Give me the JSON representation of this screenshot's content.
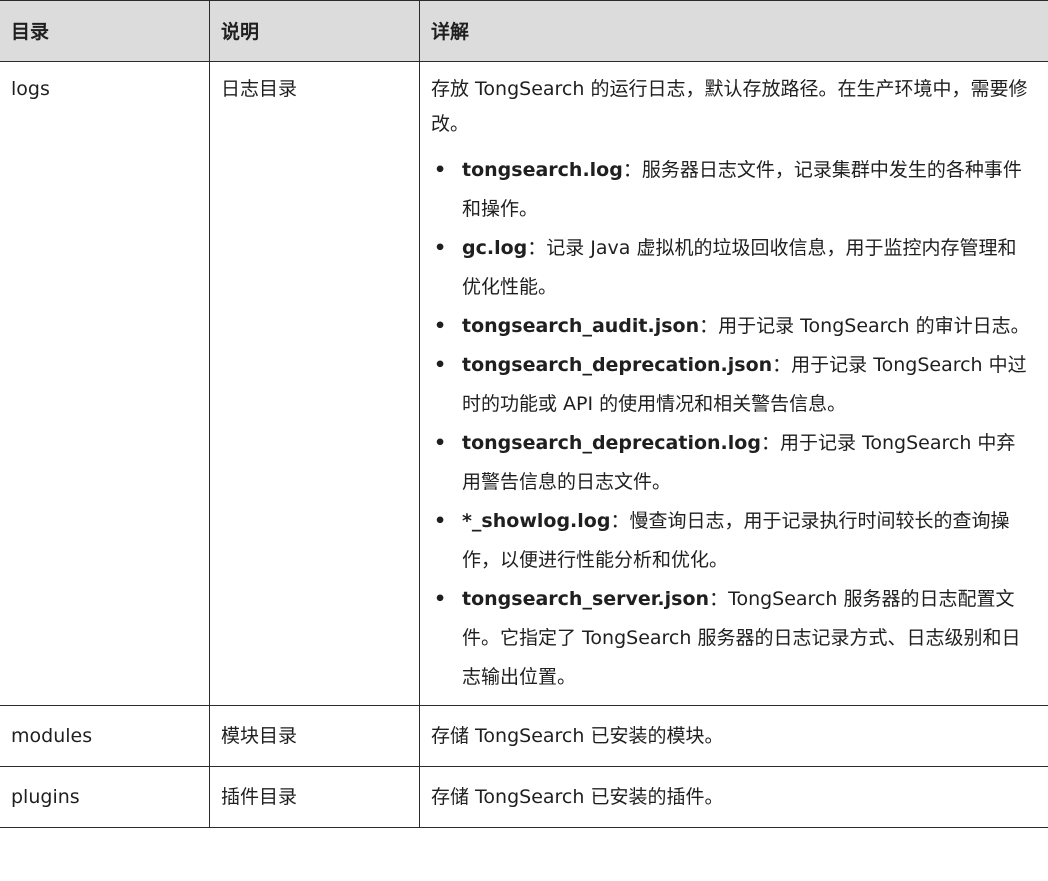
{
  "header": {
    "col_directory": "目录",
    "col_description": "说明",
    "col_details": "详解"
  },
  "rows": [
    {
      "directory": "logs",
      "description": "日志目录",
      "details": "存放 TongSearch 的运行日志，默认存放路径。在生产环境中，需要修改。",
      "files": [
        {
          "name": "tongsearch.log",
          "text": "：服务器日志文件，记录集群中发生的各种事件和操作。"
        },
        {
          "name": "gc.log",
          "text": "：记录 Java 虚拟机的垃圾回收信息，用于监控内存管理和优化性能。"
        },
        {
          "name": "tongsearch_audit.json",
          "text": "：用于记录 TongSearch 的审计日志。"
        },
        {
          "name": "tongsearch_deprecation.json",
          "text": "：用于记录 TongSearch 中过时的功能或 API 的使用情况和相关警告信息。"
        },
        {
          "name": "tongsearch_deprecation.log",
          "text": "：用于记录 TongSearch 中弃用警告信息的日志文件。"
        },
        {
          "name": "*_showlog.log",
          "text": "：慢查询日志，用于记录执行时间较长的查询操作，以便进行性能分析和优化。"
        },
        {
          "name": "tongsearch_server.json",
          "text": "：TongSearch 服务器的日志配置文件。它指定了 TongSearch 服务器的日志记录方式、日志级别和日志输出位置。"
        }
      ]
    },
    {
      "directory": "modules",
      "description": "模块目录",
      "details": "存储 TongSearch 已安装的模块。"
    },
    {
      "directory": "plugins",
      "description": "插件目录",
      "details": "存储 TongSearch 已安装的插件。"
    }
  ],
  "bullet_glyph": "•",
  "colors": {
    "header_bg": "#dcdcdc",
    "border": "#2b2b2b",
    "text": "#1f1f1f"
  }
}
